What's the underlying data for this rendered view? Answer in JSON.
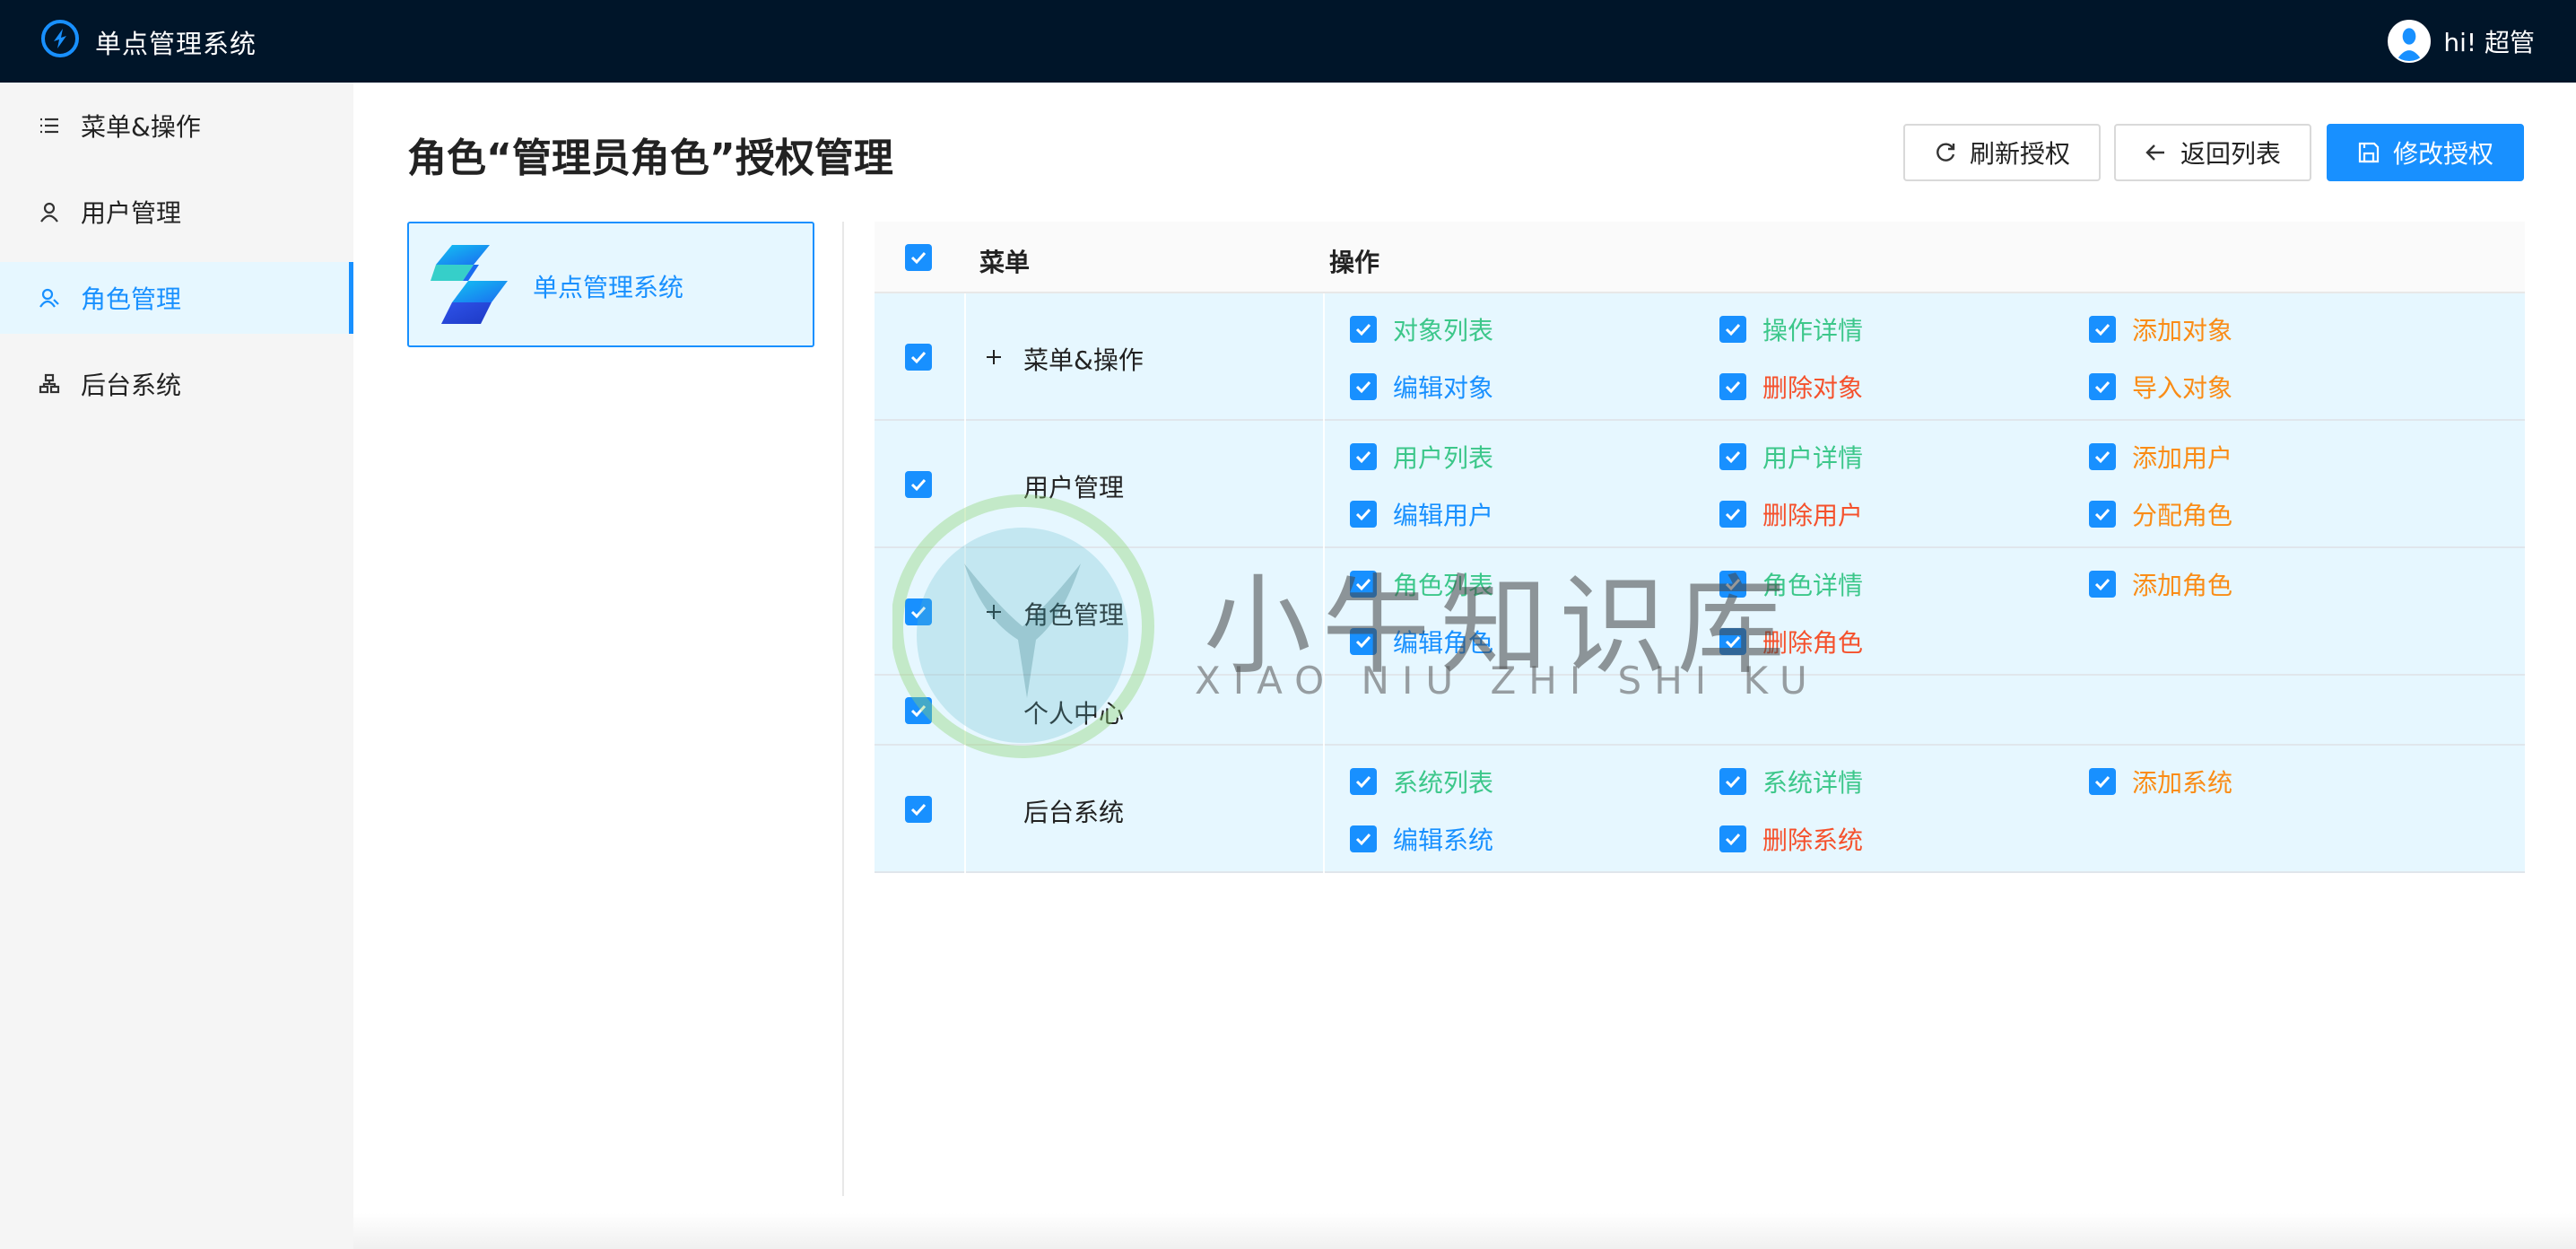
{
  "app": {
    "title": "单点管理系统",
    "user_greeting": "hi! 超管"
  },
  "sidebar": {
    "items": [
      {
        "label": "菜单&操作",
        "icon": "list-icon",
        "active": false
      },
      {
        "label": "用户管理",
        "icon": "user-icon",
        "active": false
      },
      {
        "label": "角色管理",
        "icon": "role-icon",
        "active": true
      },
      {
        "label": "后台系统",
        "icon": "cluster-icon",
        "active": false
      }
    ]
  },
  "page": {
    "title": "角色“管理员角色”授权管理"
  },
  "toolbar": {
    "refresh_label": "刷新授权",
    "back_label": "返回列表",
    "save_label": "修改授权"
  },
  "system_card": {
    "name": "单点管理系统"
  },
  "table": {
    "headers": {
      "menu": "菜单",
      "ops": "操作"
    },
    "rows": [
      {
        "menu": "菜单&操作",
        "expandable": true,
        "ops": [
          {
            "label": "对象列表",
            "color": "#3cc78a"
          },
          {
            "label": "操作详情",
            "color": "#3cc78a"
          },
          {
            "label": "添加对象",
            "color": "#fa8c16"
          },
          {
            "label": "编辑对象",
            "color": "#1890ff"
          },
          {
            "label": "删除对象",
            "color": "#f5512c"
          },
          {
            "label": "导入对象",
            "color": "#fa8c16"
          }
        ]
      },
      {
        "menu": "用户管理",
        "expandable": false,
        "ops": [
          {
            "label": "用户列表",
            "color": "#3cc78a"
          },
          {
            "label": "用户详情",
            "color": "#3cc78a"
          },
          {
            "label": "添加用户",
            "color": "#fa8c16"
          },
          {
            "label": "编辑用户",
            "color": "#1890ff"
          },
          {
            "label": "删除用户",
            "color": "#f5512c"
          },
          {
            "label": "分配角色",
            "color": "#fa8c16"
          }
        ]
      },
      {
        "menu": "角色管理",
        "expandable": true,
        "ops": [
          {
            "label": "角色列表",
            "color": "#3cc78a"
          },
          {
            "label": "角色详情",
            "color": "#3cc78a"
          },
          {
            "label": "添加角色",
            "color": "#fa8c16"
          },
          {
            "label": "编辑角色",
            "color": "#1890ff"
          },
          {
            "label": "删除角色",
            "color": "#f5512c"
          }
        ]
      },
      {
        "menu": "个人中心",
        "expandable": false,
        "ops": []
      },
      {
        "menu": "后台系统",
        "expandable": false,
        "ops": [
          {
            "label": "系统列表",
            "color": "#3cc78a"
          },
          {
            "label": "系统详情",
            "color": "#3cc78a"
          },
          {
            "label": "添加系统",
            "color": "#fa8c16"
          },
          {
            "label": "编辑系统",
            "color": "#1890ff"
          },
          {
            "label": "删除系统",
            "color": "#f5512c"
          }
        ]
      }
    ]
  },
  "watermark": {
    "title": "小牛知识库",
    "subtitle": "XIAO NIU ZHI SHI KU"
  },
  "colors": {
    "topbar": "#001529",
    "accent": "#1890ff",
    "row_bg": "#e6f7ff"
  }
}
